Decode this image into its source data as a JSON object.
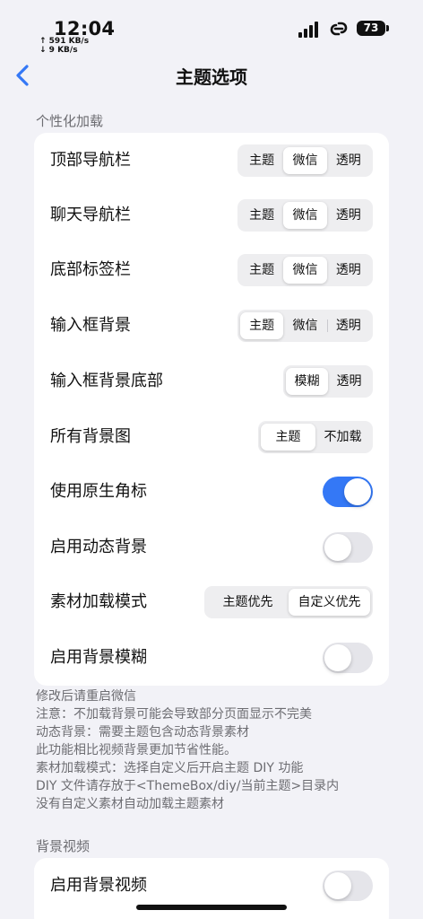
{
  "status_bar": {
    "time": "12:04",
    "upload": "↑ 591 KB/s",
    "download": "↓ 9 KB/s",
    "battery": "73"
  },
  "nav": {
    "title": "主题选项",
    "back_icon": "chevron-left-icon"
  },
  "section1": {
    "header": "个性化加载",
    "rows": [
      {
        "label": "顶部导航栏",
        "options": [
          "主题",
          "微信",
          "透明"
        ],
        "selected": "微信"
      },
      {
        "label": "聊天导航栏",
        "options": [
          "主题",
          "微信",
          "透明"
        ],
        "selected": "微信"
      },
      {
        "label": "底部标签栏",
        "options": [
          "主题",
          "微信",
          "透明"
        ],
        "selected": "微信"
      },
      {
        "label": "输入框背景",
        "options": [
          "主题",
          "微信",
          "透明"
        ],
        "selected": "主题"
      },
      {
        "label": "输入框背景底部",
        "options": [
          "模糊",
          "透明"
        ],
        "selected": "模糊"
      },
      {
        "label": "所有背景图",
        "options": [
          "主题",
          "不加载"
        ],
        "selected": "主题"
      },
      {
        "label": "使用原生角标",
        "toggle": true
      },
      {
        "label": "启用动态背景",
        "toggle": false
      },
      {
        "label": "素材加载模式",
        "options": [
          "主题优先",
          "自定义优先"
        ],
        "selected": "自定义优先"
      },
      {
        "label": "启用背景模糊",
        "toggle": false
      }
    ]
  },
  "notes": [
    "修改后请重启微信",
    "注意：不加载背景可能会导致部分页面显示不完美",
    "动态背景：需要主题包含动态背景素材",
    "此功能相比视频背景更加节省性能。",
    "素材加载模式：选择自定义后开启主题 DIY 功能",
    "DIY 文件请存放于<ThemeBox/diy/当前主题>目录内",
    "没有自定义素材自动加载主题素材"
  ],
  "section2": {
    "header": "背景视频",
    "rows": [
      {
        "label": "启用背景视频",
        "toggle": false
      }
    ]
  },
  "colors": {
    "accent": "#3478f6",
    "background": "#f2f2f7",
    "toggle_off": "#e5e5ea"
  }
}
